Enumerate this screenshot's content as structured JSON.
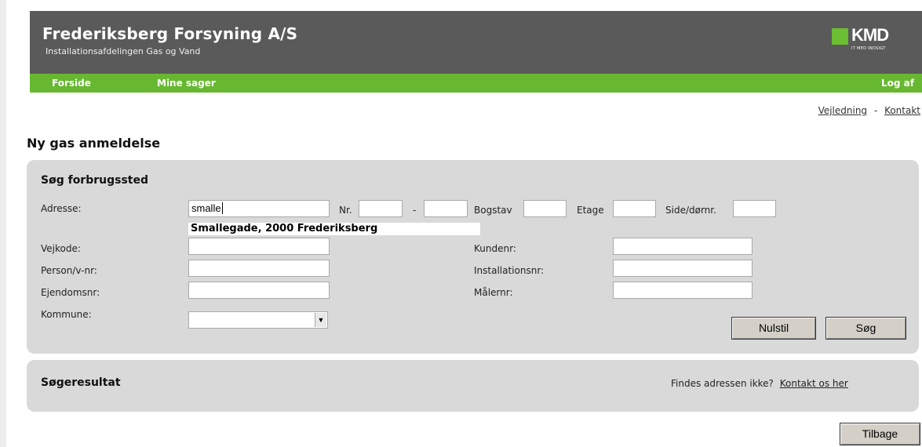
{
  "header": {
    "company": "Frederiksberg Forsyning A/S",
    "department": "Installationsafdelingen Gas og Vand",
    "logo_text": "KMD",
    "logo_tagline": "IT MED INDSIGT",
    "brand_green": "#67b830",
    "header_gray": "#5a5a5a"
  },
  "nav": {
    "items": [
      {
        "label": "Forside"
      },
      {
        "label": "Mine sager"
      }
    ],
    "logout": "Log af"
  },
  "toplinks": {
    "guide": "Vejledning",
    "separator": "-",
    "contact": "Kontakt"
  },
  "page": {
    "title": "Ny gas anmeldelse"
  },
  "search": {
    "heading": "Søg forbrugssted",
    "address_label": "Adresse:",
    "address_value": "smalle",
    "nr_label": "Nr.",
    "nr_value": "",
    "dash": "-",
    "nr_to_value": "",
    "bogstav_label": "Bogstav",
    "bogstav_value": "",
    "etage_label": "Etage",
    "etage_value": "",
    "side_label": "Side/dørnr.",
    "side_value": "",
    "suggestion": "Smallegade, 2000 Frederiksberg",
    "vejkode_label": "Vejkode:",
    "vejkode_value": "",
    "person_label": "Person/v-nr:",
    "person_value": "",
    "ejendom_label": "Ejendomsnr:",
    "ejendom_value": "",
    "kommune_label": "Kommune:",
    "kommune_value": "",
    "kundenr_label": "Kundenr:",
    "kundenr_value": "",
    "installation_label": "Installationsnr:",
    "installation_value": "",
    "maaler_label": "Målernr:",
    "maaler_value": "",
    "reset_label": "Nulstil",
    "search_label": "Søg"
  },
  "results": {
    "heading": "Søgeresultat",
    "missing_question": "Findes adressen ikke?",
    "contact_link": "Kontakt os her"
  },
  "footer": {
    "back_label": "Tilbage"
  }
}
